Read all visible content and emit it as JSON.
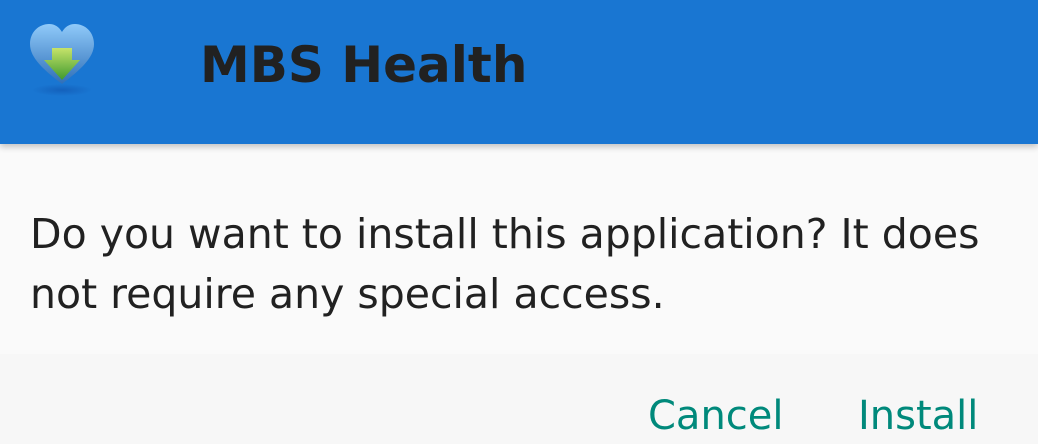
{
  "header": {
    "app_name": "MBS Health",
    "app_icon": "heart-arrow-icon",
    "background_color": "#1976d2"
  },
  "dialog": {
    "message": "Do you want to install this application? It does not require any special access."
  },
  "actions": {
    "cancel_label": "Cancel",
    "install_label": "Install",
    "accent_color": "#00897b"
  }
}
